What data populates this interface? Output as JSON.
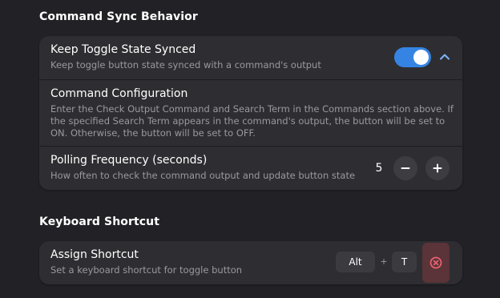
{
  "sections": {
    "sync_title": "Command Sync Behavior",
    "shortcut_title": "Keyboard Shortcut"
  },
  "sync": {
    "toggle_row": {
      "title": "Keep Toggle State Synced",
      "subtitle": "Keep toggle button state synced with a command's output",
      "enabled": true,
      "expanded": true
    },
    "config_row": {
      "title": "Command Configuration",
      "description": "Enter the Check Output Command and Search Term in the Commands section above. If the specified Search Term appears in the command's output, the button will be set to ON. Otherwise, the button will be set to OFF."
    },
    "polling_row": {
      "title": "Polling Frequency (seconds)",
      "subtitle": "How often to check the command output and update button state",
      "value": "5"
    }
  },
  "shortcut": {
    "assign_row": {
      "title": "Assign Shortcut",
      "subtitle": "Set a keyboard shortcut for toggle button",
      "modifier_key": "Alt",
      "separator": "+",
      "key": "T"
    }
  },
  "colors": {
    "accent": "#3584e4",
    "destructive": "#e66170",
    "background": "#222226",
    "card": "#2e2e32"
  },
  "icons": {
    "expander": "chevron-up-icon",
    "decrement": "minus-icon",
    "increment": "plus-icon",
    "clear": "clear-circle-icon"
  }
}
